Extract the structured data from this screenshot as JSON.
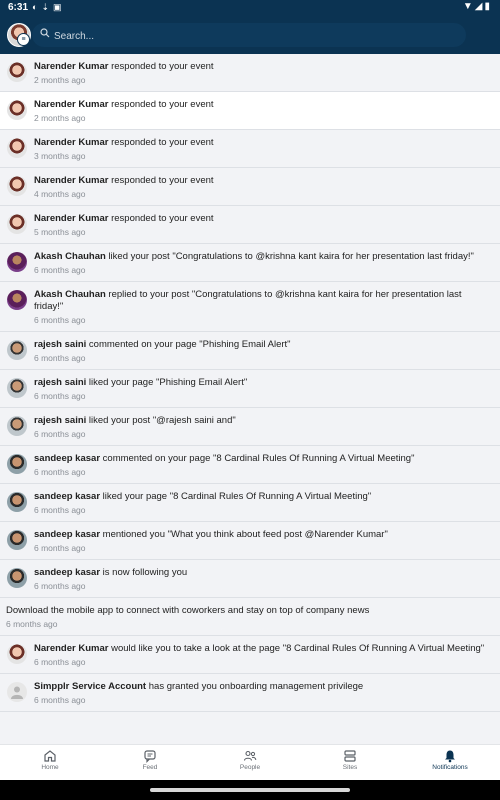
{
  "status_bar": {
    "time": "6:31",
    "left_icons": [
      "shield-icon",
      "usb-icon",
      "app-icon"
    ],
    "right_icons": [
      "wifi-icon",
      "signal-icon",
      "battery-icon"
    ]
  },
  "header": {
    "search_placeholder": "Search..."
  },
  "notifications": [
    {
      "actor": "Narender Kumar",
      "text": " responded to your event",
      "time": "2 months ago",
      "avatar": "narender"
    },
    {
      "actor": "Narender Kumar",
      "text": " responded to your event",
      "time": "2 months ago",
      "avatar": "narender",
      "highlighted": true
    },
    {
      "actor": "Narender Kumar",
      "text": " responded to your event",
      "time": "3 months ago",
      "avatar": "narender"
    },
    {
      "actor": "Narender Kumar",
      "text": " responded to your event",
      "time": "4 months ago",
      "avatar": "narender"
    },
    {
      "actor": "Narender Kumar",
      "text": " responded to your event",
      "time": "5 months ago",
      "avatar": "narender"
    },
    {
      "actor": "Akash Chauhan",
      "text": " liked your post \"Congratulations to @krishna kant kaira for her presentation last friday!\"",
      "time": "6 months ago",
      "avatar": "akash"
    },
    {
      "actor": "Akash Chauhan",
      "text": " replied to your post \"Congratulations to @krishna kant kaira for her presentation last friday!\"",
      "time": "6 months ago",
      "avatar": "akash"
    },
    {
      "actor": "rajesh saini",
      "text": " commented on your page \"Phishing Email Alert\"",
      "time": "6 months ago",
      "avatar": "rajesh"
    },
    {
      "actor": "rajesh saini",
      "text": " liked your page \"Phishing Email Alert\"",
      "time": "6 months ago",
      "avatar": "rajesh"
    },
    {
      "actor": "rajesh saini",
      "text": " liked your post \"@rajesh saini and\"",
      "time": "6 months ago",
      "avatar": "rajesh"
    },
    {
      "actor": "sandeep kasar",
      "text": " commented on your page \"8 Cardinal Rules Of Running A Virtual Meeting\"",
      "time": "6 months ago",
      "avatar": "sandeep"
    },
    {
      "actor": "sandeep kasar",
      "text": " liked your page \"8 Cardinal Rules Of Running A Virtual Meeting\"",
      "time": "6 months ago",
      "avatar": "sandeep"
    },
    {
      "actor": "sandeep kasar",
      "text": " mentioned you \"What you think about feed post @Narender Kumar\"",
      "time": "6 months ago",
      "avatar": "sandeep"
    },
    {
      "actor": "sandeep kasar",
      "text": " is now following you",
      "time": "6 months ago",
      "avatar": "sandeep"
    },
    {
      "actor": "",
      "text": "Download the mobile app to connect with coworkers and stay on top of company news",
      "time": "6 months ago",
      "avatar": ""
    },
    {
      "actor": "Narender Kumar",
      "text": " would like you to take a look at the page \"8 Cardinal Rules Of Running A Virtual Meeting\"",
      "time": "6 months ago",
      "avatar": "narender"
    },
    {
      "actor": "Simpplr Service Account",
      "text": " has granted you onboarding management privilege",
      "time": "6 months ago",
      "avatar": "generic"
    }
  ],
  "bottom_nav": [
    {
      "label": "Home",
      "icon": "home-icon"
    },
    {
      "label": "Feed",
      "icon": "feed-icon"
    },
    {
      "label": "People",
      "icon": "people-icon"
    },
    {
      "label": "Sites",
      "icon": "sites-icon"
    },
    {
      "label": "Notifications",
      "icon": "bell-icon",
      "active": true
    }
  ],
  "colors": {
    "header_bg": "#0b3352",
    "list_bg": "#f2f3f6",
    "highlight_bg": "#ffffff",
    "active_nav": "#0b3352"
  }
}
